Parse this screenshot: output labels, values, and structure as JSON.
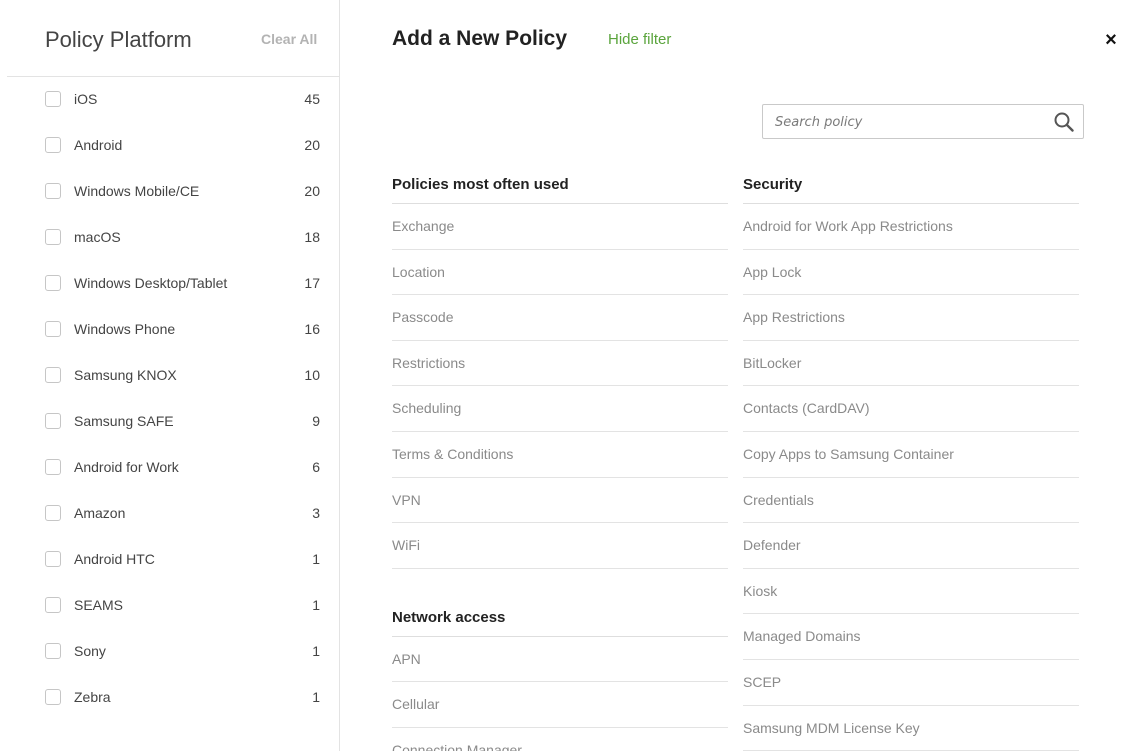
{
  "sidebar": {
    "title": "Policy Platform",
    "clear_all": "Clear All",
    "platforms": [
      {
        "label": "iOS",
        "count": "45"
      },
      {
        "label": "Android",
        "count": "20"
      },
      {
        "label": "Windows Mobile/CE",
        "count": "20"
      },
      {
        "label": "macOS",
        "count": "18"
      },
      {
        "label": "Windows Desktop/Tablet",
        "count": "17"
      },
      {
        "label": "Windows Phone",
        "count": "16"
      },
      {
        "label": "Samsung KNOX",
        "count": "10"
      },
      {
        "label": "Samsung SAFE",
        "count": "9"
      },
      {
        "label": "Android for Work",
        "count": "6"
      },
      {
        "label": "Amazon",
        "count": "3"
      },
      {
        "label": "Android HTC",
        "count": "1"
      },
      {
        "label": "SEAMS",
        "count": "1"
      },
      {
        "label": "Sony",
        "count": "1"
      },
      {
        "label": "Zebra",
        "count": "1"
      }
    ]
  },
  "main": {
    "title": "Add a New Policy",
    "hide_filter": "Hide filter",
    "close_label": "×",
    "search": {
      "placeholder": "Search policy",
      "value": ""
    },
    "most_used": {
      "title": "Policies most often used",
      "items": [
        "Exchange",
        "Location",
        "Passcode",
        "Restrictions",
        "Scheduling",
        "Terms & Conditions",
        "VPN",
        "WiFi"
      ]
    },
    "network_access": {
      "title": "Network access",
      "items": [
        "APN",
        "Cellular",
        "Connection Manager"
      ]
    },
    "security": {
      "title": "Security",
      "items": [
        "Android for Work App Restrictions",
        "App Lock",
        "App Restrictions",
        "BitLocker",
        "Contacts (CardDAV)",
        "Copy Apps to Samsung Container",
        "Credentials",
        "Defender",
        "Kiosk",
        "Managed Domains",
        "SCEP",
        "Samsung MDM License Key"
      ]
    }
  },
  "colors": {
    "accent_green": "#5aa43c",
    "muted_text": "#8a8a8a",
    "border": "#e3e3e3"
  },
  "icons": {
    "search": "search-icon",
    "close": "close-icon",
    "checkbox": "checkbox-icon"
  }
}
